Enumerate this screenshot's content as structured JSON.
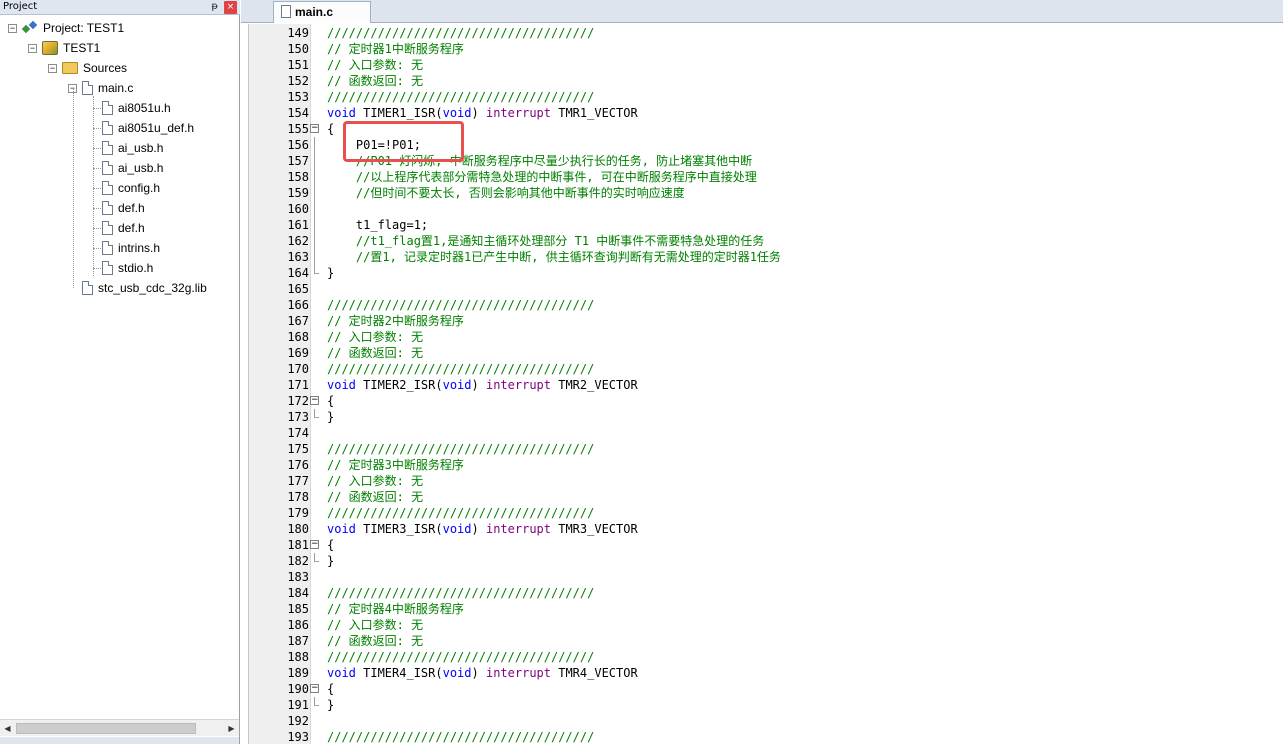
{
  "project_panel": {
    "title": "Project",
    "pin_glyph": "ᵽ",
    "close_glyph": "×",
    "tree": [
      {
        "label": "Project: TEST1",
        "icon": "project-icon",
        "expander": "−"
      },
      {
        "label": "TEST1",
        "icon": "target-icon",
        "expander": "−"
      },
      {
        "label": "Sources",
        "icon": "folder-icon",
        "expander": "−"
      },
      {
        "label": "main.c",
        "icon": "file-icon",
        "expander": "−"
      },
      {
        "label": "ai8051u.h",
        "icon": "file-icon"
      },
      {
        "label": "ai8051u_def.h",
        "icon": "file-icon"
      },
      {
        "label": "ai_usb.h",
        "icon": "file-icon"
      },
      {
        "label": "ai_usb.h",
        "icon": "file-icon"
      },
      {
        "label": "config.h",
        "icon": "file-icon"
      },
      {
        "label": "def.h",
        "icon": "file-icon"
      },
      {
        "label": "def.h",
        "icon": "file-icon"
      },
      {
        "label": "intrins.h",
        "icon": "file-icon"
      },
      {
        "label": "stdio.h",
        "icon": "file-icon"
      },
      {
        "label": "stc_usb_cdc_32g.lib",
        "icon": "file-icon"
      }
    ],
    "scroll_left": "◀",
    "scroll_right": "▶"
  },
  "editor": {
    "active_tab": "main.c",
    "lines": [
      {
        "n": "149",
        "parts": [
          [
            "cm",
            "/////////////////////////////////////"
          ]
        ]
      },
      {
        "n": "150",
        "parts": [
          [
            "cm",
            "// 定时器1中断服务程序"
          ]
        ]
      },
      {
        "n": "151",
        "parts": [
          [
            "cm",
            "// 入口参数: 无"
          ]
        ]
      },
      {
        "n": "152",
        "parts": [
          [
            "cm",
            "// 函数返回: 无"
          ]
        ]
      },
      {
        "n": "153",
        "parts": [
          [
            "cm",
            "/////////////////////////////////////"
          ]
        ]
      },
      {
        "n": "154",
        "parts": [
          [
            "kw",
            "void"
          ],
          [
            "fn",
            " TIMER1_ISR("
          ],
          [
            "kw",
            "void"
          ],
          [
            "fn",
            ") "
          ],
          [
            "kw2",
            "interrupt"
          ],
          [
            "fn",
            " TMR1_VECTOR"
          ]
        ]
      },
      {
        "n": "155",
        "parts": [
          [
            "fn",
            "{"
          ]
        ],
        "fold": "open"
      },
      {
        "n": "156",
        "parts": [
          [
            "fn",
            "    P01=!P01;"
          ]
        ],
        "fold": "line"
      },
      {
        "n": "157",
        "parts": [
          [
            "cm",
            "    //P01 灯闪烁, 中断服务程序中尽量少执行长的任务, 防止堵塞其他中断"
          ]
        ],
        "fold": "line"
      },
      {
        "n": "158",
        "parts": [
          [
            "cm",
            "    //以上程序代表部分需特急处理的中断事件, 可在中断服务程序中直接处理"
          ]
        ],
        "fold": "line"
      },
      {
        "n": "159",
        "parts": [
          [
            "cm",
            "    //但时间不要太长, 否则会影响其他中断事件的实时响应速度"
          ]
        ],
        "fold": "line"
      },
      {
        "n": "160",
        "parts": [
          [
            "fn",
            ""
          ]
        ],
        "fold": "line"
      },
      {
        "n": "161",
        "parts": [
          [
            "fn",
            "    t1_flag=1;"
          ]
        ],
        "fold": "line"
      },
      {
        "n": "162",
        "parts": [
          [
            "cm",
            "    //t1_flag置1,是通知主循环处理部分 T1 中断事件不需要特急处理的任务"
          ]
        ],
        "fold": "line"
      },
      {
        "n": "163",
        "parts": [
          [
            "cm",
            "    //置1, 记录定时器1已产生中断, 供主循环查询判断有无需处理的定时器1任务"
          ]
        ],
        "fold": "line"
      },
      {
        "n": "164",
        "parts": [
          [
            "fn",
            "}"
          ]
        ],
        "fold": "end"
      },
      {
        "n": "165",
        "parts": [
          [
            "fn",
            ""
          ]
        ]
      },
      {
        "n": "166",
        "parts": [
          [
            "cm",
            "/////////////////////////////////////"
          ]
        ]
      },
      {
        "n": "167",
        "parts": [
          [
            "cm",
            "// 定时器2中断服务程序"
          ]
        ]
      },
      {
        "n": "168",
        "parts": [
          [
            "cm",
            "// 入口参数: 无"
          ]
        ]
      },
      {
        "n": "169",
        "parts": [
          [
            "cm",
            "// 函数返回: 无"
          ]
        ]
      },
      {
        "n": "170",
        "parts": [
          [
            "cm",
            "/////////////////////////////////////"
          ]
        ]
      },
      {
        "n": "171",
        "parts": [
          [
            "kw",
            "void"
          ],
          [
            "fn",
            " TIMER2_ISR("
          ],
          [
            "kw",
            "void"
          ],
          [
            "fn",
            ") "
          ],
          [
            "kw2",
            "interrupt"
          ],
          [
            "fn",
            " TMR2_VECTOR"
          ]
        ]
      },
      {
        "n": "172",
        "parts": [
          [
            "fn",
            "{"
          ]
        ],
        "fold": "open"
      },
      {
        "n": "173",
        "parts": [
          [
            "fn",
            "}"
          ]
        ],
        "fold": "end"
      },
      {
        "n": "174",
        "parts": [
          [
            "fn",
            ""
          ]
        ]
      },
      {
        "n": "175",
        "parts": [
          [
            "cm",
            "/////////////////////////////////////"
          ]
        ]
      },
      {
        "n": "176",
        "parts": [
          [
            "cm",
            "// 定时器3中断服务程序"
          ]
        ]
      },
      {
        "n": "177",
        "parts": [
          [
            "cm",
            "// 入口参数: 无"
          ]
        ]
      },
      {
        "n": "178",
        "parts": [
          [
            "cm",
            "// 函数返回: 无"
          ]
        ]
      },
      {
        "n": "179",
        "parts": [
          [
            "cm",
            "/////////////////////////////////////"
          ]
        ]
      },
      {
        "n": "180",
        "parts": [
          [
            "kw",
            "void"
          ],
          [
            "fn",
            " TIMER3_ISR("
          ],
          [
            "kw",
            "void"
          ],
          [
            "fn",
            ") "
          ],
          [
            "kw2",
            "interrupt"
          ],
          [
            "fn",
            " TMR3_VECTOR"
          ]
        ]
      },
      {
        "n": "181",
        "parts": [
          [
            "fn",
            "{"
          ]
        ],
        "fold": "open"
      },
      {
        "n": "182",
        "parts": [
          [
            "fn",
            "}"
          ]
        ],
        "fold": "end"
      },
      {
        "n": "183",
        "parts": [
          [
            "fn",
            ""
          ]
        ]
      },
      {
        "n": "184",
        "parts": [
          [
            "cm",
            "/////////////////////////////////////"
          ]
        ]
      },
      {
        "n": "185",
        "parts": [
          [
            "cm",
            "// 定时器4中断服务程序"
          ]
        ]
      },
      {
        "n": "186",
        "parts": [
          [
            "cm",
            "// 入口参数: 无"
          ]
        ]
      },
      {
        "n": "187",
        "parts": [
          [
            "cm",
            "// 函数返回: 无"
          ]
        ]
      },
      {
        "n": "188",
        "parts": [
          [
            "cm",
            "/////////////////////////////////////"
          ]
        ]
      },
      {
        "n": "189",
        "parts": [
          [
            "kw",
            "void"
          ],
          [
            "fn",
            " TIMER4_ISR("
          ],
          [
            "kw",
            "void"
          ],
          [
            "fn",
            ") "
          ],
          [
            "kw2",
            "interrupt"
          ],
          [
            "fn",
            " TMR4_VECTOR"
          ]
        ]
      },
      {
        "n": "190",
        "parts": [
          [
            "fn",
            "{"
          ]
        ],
        "fold": "open"
      },
      {
        "n": "191",
        "parts": [
          [
            "fn",
            "}"
          ]
        ],
        "fold": "end"
      },
      {
        "n": "192",
        "parts": [
          [
            "fn",
            ""
          ]
        ]
      },
      {
        "n": "193",
        "parts": [
          [
            "cm",
            "/////////////////////////////////////"
          ]
        ]
      }
    ],
    "highlight_color": "#e8504f"
  }
}
